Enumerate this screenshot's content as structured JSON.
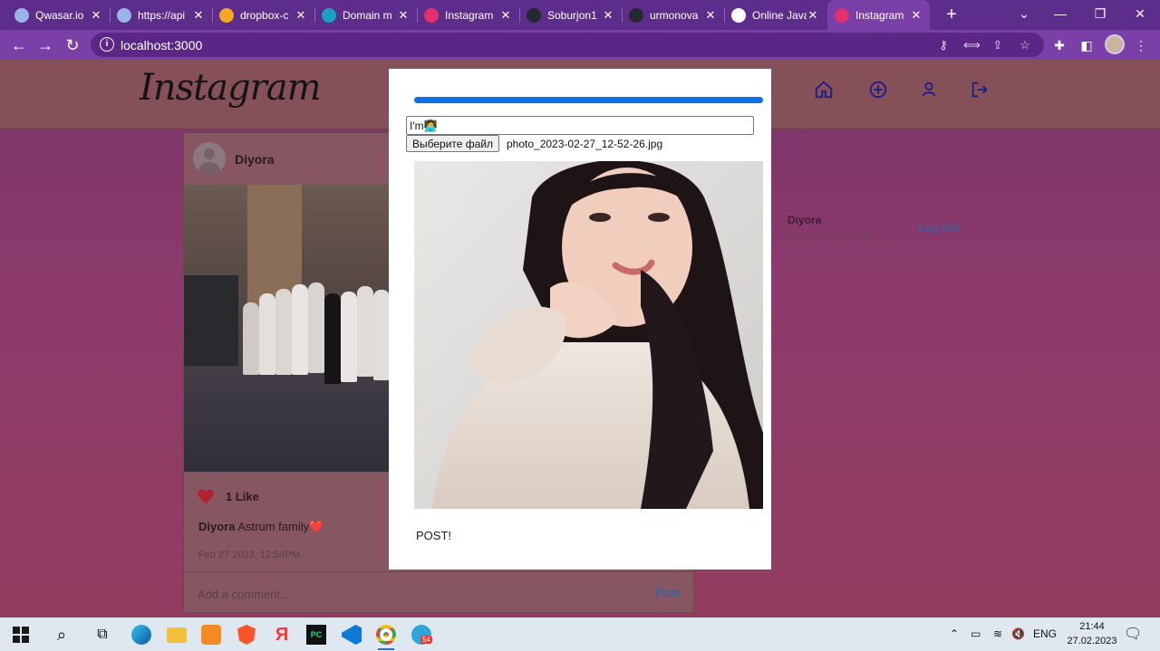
{
  "browser": {
    "tabs": [
      {
        "title": "Qwasar.io",
        "icon": "qwasar-icon",
        "color": "#9ab3e8"
      },
      {
        "title": "https://api",
        "icon": "qwasar-icon",
        "color": "#9ab3e8"
      },
      {
        "title": "dropbox-c",
        "icon": "fire-icon",
        "color": "#f5a623"
      },
      {
        "title": "Domain m",
        "icon": "diamond-icon",
        "color": "#1aa0c4"
      },
      {
        "title": "Instagram",
        "icon": "instagram-icon",
        "color": "#e1306c"
      },
      {
        "title": "Soburjon1",
        "icon": "github-icon",
        "color": "#24292f"
      },
      {
        "title": "urmonova",
        "icon": "github-icon",
        "color": "#24292f"
      },
      {
        "title": "Online Java",
        "icon": "globe-icon",
        "color": "#ffffff"
      },
      {
        "title": "Instagram",
        "icon": "instagram-icon",
        "color": "#e1306c",
        "active": true
      }
    ],
    "close_glyph": "✕",
    "new_tab_glyph": "+",
    "url": "localhost:3000"
  },
  "instagram": {
    "logo": "Instagram",
    "feed_post": {
      "username": "Diyora",
      "likes": "1 Like",
      "caption_user": "Diyora",
      "caption_text": " Astrum family❤️",
      "timestamp": "Feb 27 2023, 12:54PM",
      "comment_placeholder": "Add a comment...",
      "post_label": "Post"
    },
    "sidebar": {
      "username": "Diyora",
      "full_name": "Ormonova Diyora",
      "logout_label": "Log Out"
    }
  },
  "modal": {
    "progress": 1.0,
    "caption_value": "I'm👩‍💻",
    "file_button_label": "Выберите файл",
    "file_name": "photo_2023-02-27_12-52-26.jpg",
    "post_button_label": "POST!"
  },
  "taskbar": {
    "language": "ENG",
    "time": "21:44",
    "date": "27.02.2023",
    "telegram_badge": "54"
  }
}
